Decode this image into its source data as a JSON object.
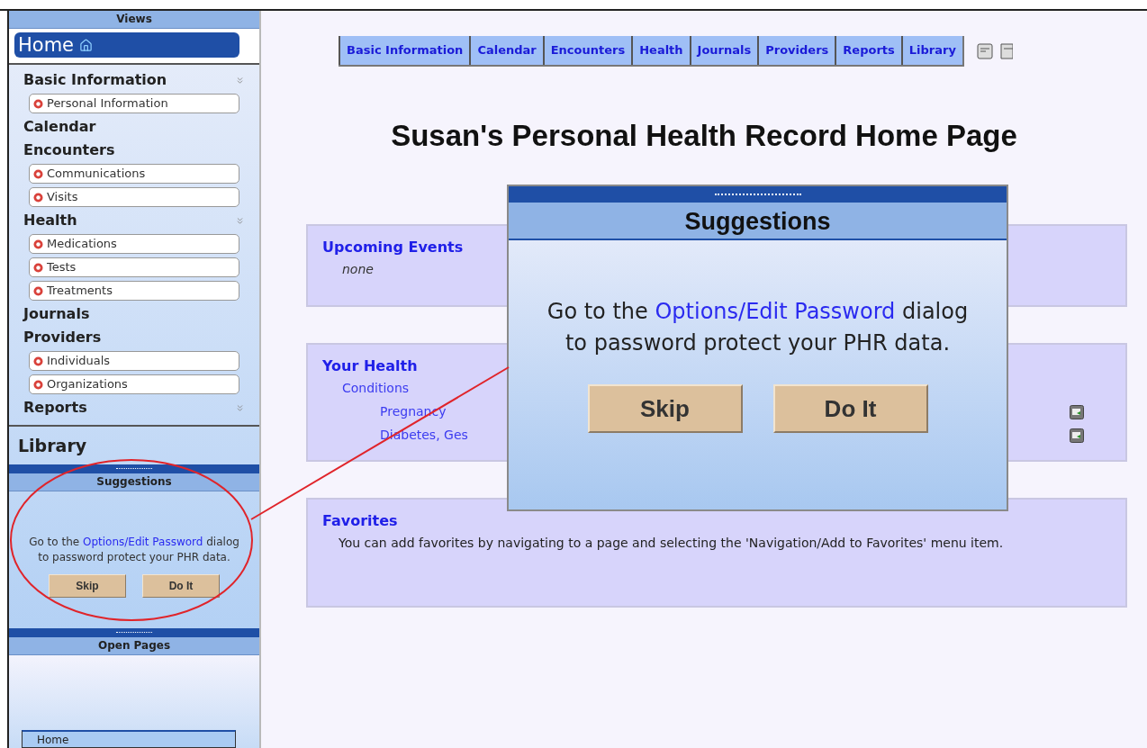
{
  "sidebar": {
    "header": "Views",
    "home": "Home",
    "sections": [
      {
        "label": "Basic Information",
        "collapsible": true,
        "children": [
          "Personal Information"
        ]
      },
      {
        "label": "Calendar",
        "collapsible": false
      },
      {
        "label": "Encounters",
        "collapsible": false,
        "children": [
          "Communications",
          "Visits"
        ]
      },
      {
        "label": "Health",
        "collapsible": true,
        "children": [
          "Medications",
          "Tests",
          "Treatments"
        ]
      },
      {
        "label": "Journals",
        "collapsible": false
      },
      {
        "label": "Providers",
        "collapsible": false,
        "children": [
          "Individuals",
          "Organizations"
        ]
      },
      {
        "label": "Reports",
        "collapsible": true
      }
    ],
    "library": "Library",
    "suggestions": {
      "title": "Suggestions",
      "before": "Go to the",
      "link": "Options/Edit Password",
      "after": "dialog to password protect your PHR data.",
      "buttons": [
        "Skip",
        "Do It"
      ]
    },
    "open_pages": {
      "title": "Open Pages",
      "items": [
        "Home"
      ]
    }
  },
  "tabs": [
    {
      "label": "Basic Information",
      "selected": false
    },
    {
      "label": "Calendar",
      "selected": false
    },
    {
      "label": "Encounters",
      "selected": false
    },
    {
      "label": "Health",
      "selected": false
    },
    {
      "label": "Journals",
      "selected": false
    },
    {
      "label": "Providers",
      "selected": false
    },
    {
      "label": "Reports",
      "selected": false
    },
    {
      "label": "Library",
      "selected": false
    }
  ],
  "page_title": "Susan's Personal Health Record Home Page",
  "cards": [
    {
      "kind": "list",
      "title": "Upcoming Events",
      "items": [
        {
          "kind": "note",
          "text": "none"
        }
      ]
    },
    {
      "kind": "list",
      "title": "Your Health",
      "items": [
        {
          "kind": "link",
          "text": "Conditions",
          "children": [
            {
              "kind": "link",
              "text": "Pregnancy",
              "action": true
            },
            {
              "kind": "link",
              "text": "Diabetes, Ges",
              "action": true
            }
          ]
        }
      ]
    },
    {
      "kind": "text",
      "title": "Favorites",
      "text": "You can add favorites by navigating to a page and selecting the 'Navigation/Add to Favorites' menu item."
    }
  ],
  "dialog": {
    "title": "Suggestions",
    "before": "Go to the",
    "link": "Options/Edit Password",
    "after": "dialog to password protect your PHR data.",
    "buttons": [
      "Skip",
      "Do It"
    ]
  }
}
